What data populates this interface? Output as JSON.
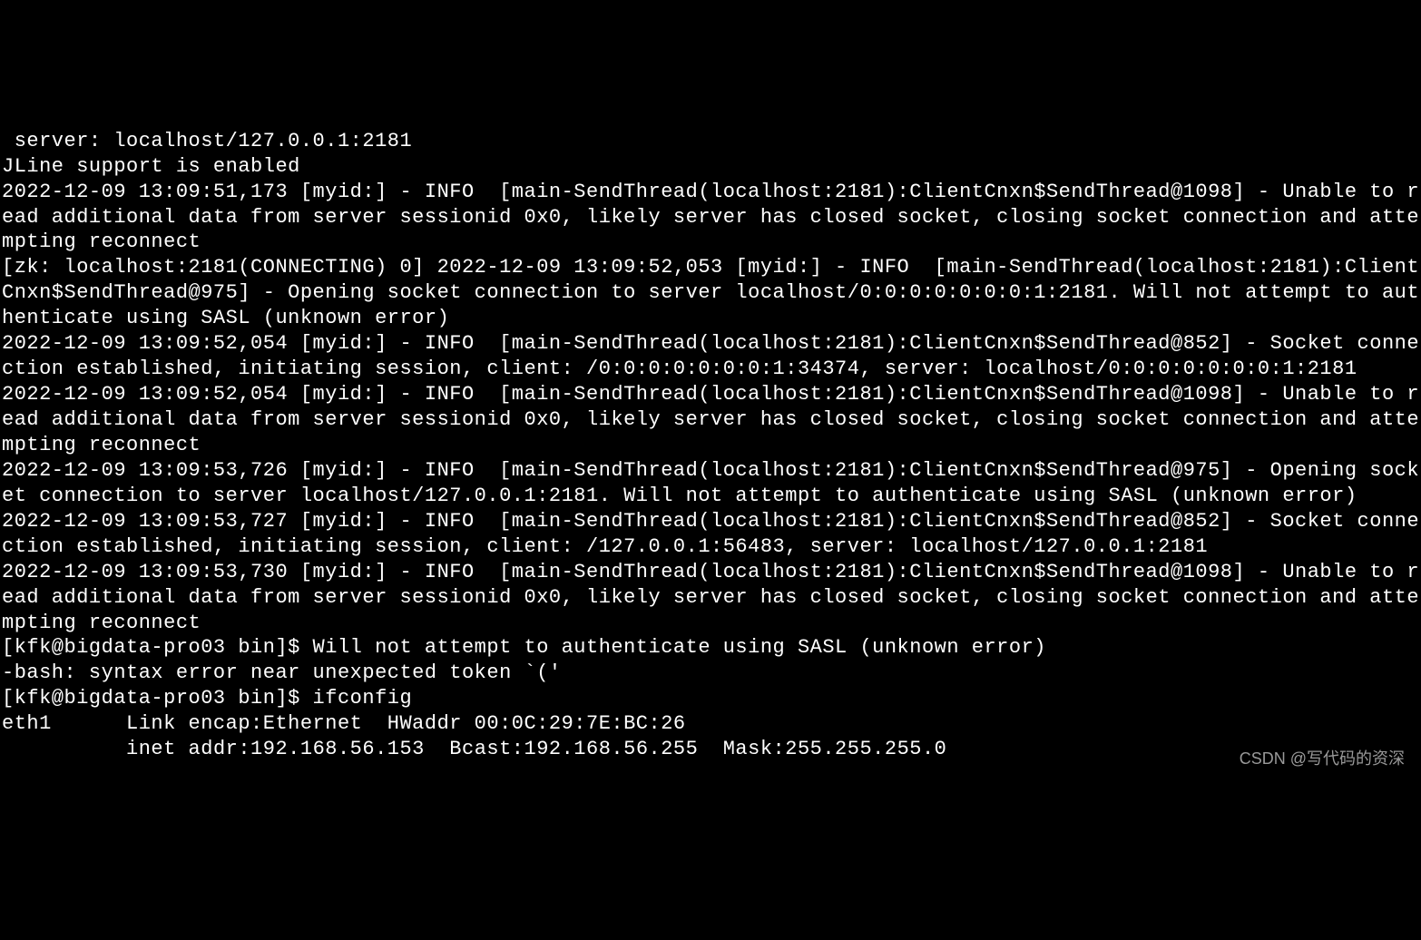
{
  "terminal": {
    "lines": [
      " server: localhost/127.0.0.1:2181",
      "JLine support is enabled",
      "2022-12-09 13:09:51,173 [myid:] - INFO  [main-SendThread(localhost:2181):ClientCnxn$SendThread@1098] - Unable to read additional data from server sessionid 0x0, likely server has closed socket, closing socket connection and attempting reconnect",
      "[zk: localhost:2181(CONNECTING) 0] 2022-12-09 13:09:52,053 [myid:] - INFO  [main-SendThread(localhost:2181):ClientCnxn$SendThread@975] - Opening socket connection to server localhost/0:0:0:0:0:0:0:1:2181. Will not attempt to authenticate using SASL (unknown error)",
      "2022-12-09 13:09:52,054 [myid:] - INFO  [main-SendThread(localhost:2181):ClientCnxn$SendThread@852] - Socket connection established, initiating session, client: /0:0:0:0:0:0:0:1:34374, server: localhost/0:0:0:0:0:0:0:1:2181",
      "2022-12-09 13:09:52,054 [myid:] - INFO  [main-SendThread(localhost:2181):ClientCnxn$SendThread@1098] - Unable to read additional data from server sessionid 0x0, likely server has closed socket, closing socket connection and attempting reconnect",
      "2022-12-09 13:09:53,726 [myid:] - INFO  [main-SendThread(localhost:2181):ClientCnxn$SendThread@975] - Opening socket connection to server localhost/127.0.0.1:2181. Will not attempt to authenticate using SASL (unknown error)",
      "2022-12-09 13:09:53,727 [myid:] - INFO  [main-SendThread(localhost:2181):ClientCnxn$SendThread@852] - Socket connection established, initiating session, client: /127.0.0.1:56483, server: localhost/127.0.0.1:2181",
      "2022-12-09 13:09:53,730 [myid:] - INFO  [main-SendThread(localhost:2181):ClientCnxn$SendThread@1098] - Unable to read additional data from server sessionid 0x0, likely server has closed socket, closing socket connection and attempting reconnect",
      "[kfk@bigdata-pro03 bin]$ Will not attempt to authenticate using SASL (unknown error)",
      "-bash: syntax error near unexpected token `('",
      "[kfk@bigdata-pro03 bin]$ ifconfig",
      "eth1      Link encap:Ethernet  HWaddr 00:0C:29:7E:BC:26",
      "          inet addr:192.168.56.153  Bcast:192.168.56.255  Mask:255.255.255.0"
    ]
  },
  "watermark": {
    "text": "CSDN @写代码的资深"
  }
}
